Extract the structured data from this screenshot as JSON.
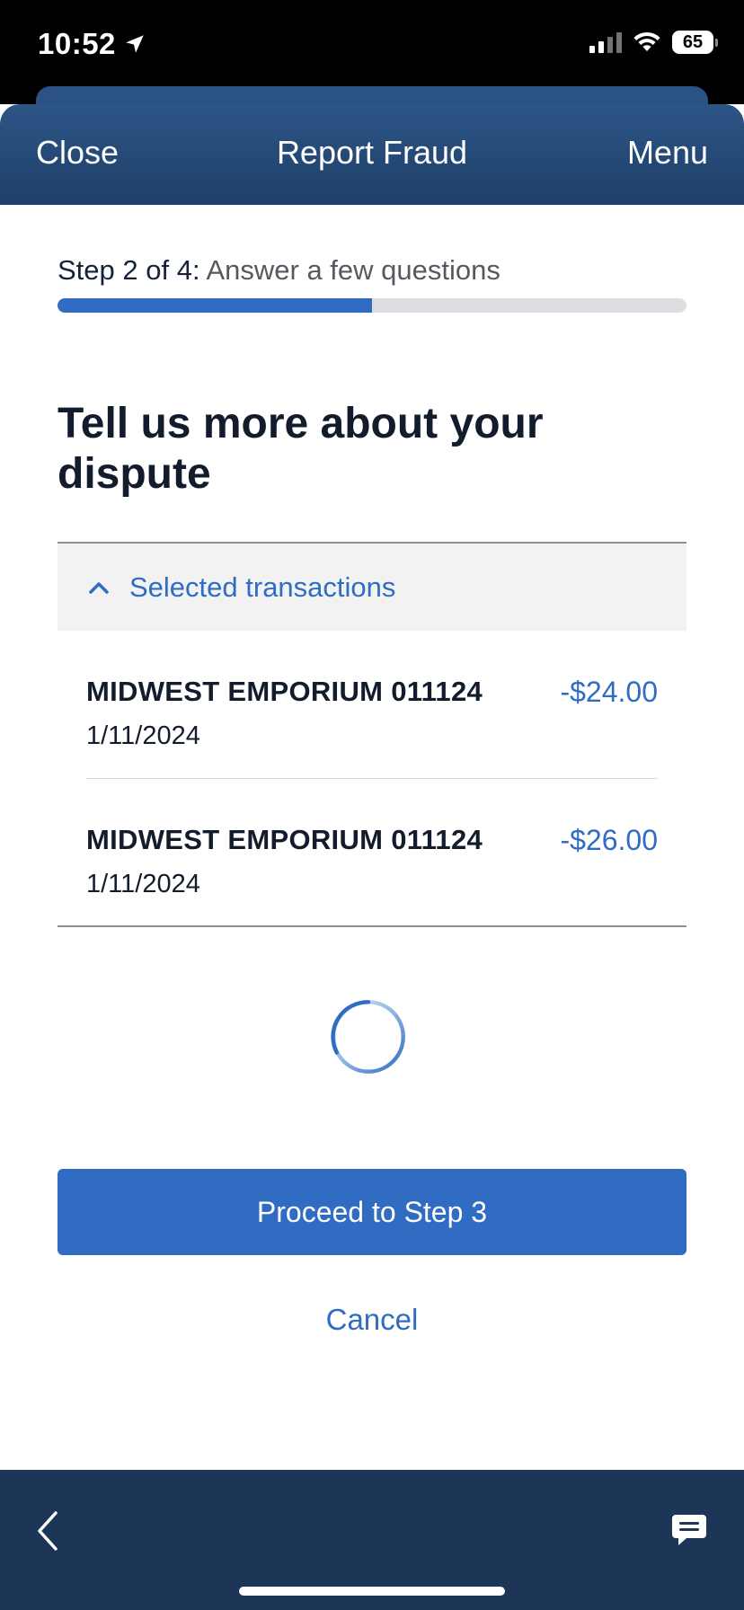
{
  "status_bar": {
    "time": "10:52",
    "battery_level": "65",
    "icons": [
      "location-arrow-icon",
      "cellular-signal-icon",
      "wifi-icon",
      "battery-icon"
    ]
  },
  "header": {
    "close_label": "Close",
    "title": "Report Fraud",
    "menu_label": "Menu"
  },
  "step": {
    "prefix": "Step 2 of 4:",
    "description": "Answer a few questions",
    "progress_fraction": 0.5
  },
  "main": {
    "heading": "Tell us more about your dispute"
  },
  "transactions": {
    "section_label": "Selected transactions",
    "expanded": true,
    "items": [
      {
        "merchant": "MIDWEST EMPORIUM 011124",
        "date": "1/11/2024",
        "amount": "-$24.00"
      },
      {
        "merchant": "MIDWEST EMPORIUM 011124",
        "date": "1/11/2024",
        "amount": "-$26.00"
      }
    ]
  },
  "actions": {
    "proceed_label": "Proceed to Step 3",
    "cancel_label": "Cancel"
  },
  "bottom_bar": {
    "icons": [
      "back-chevron-icon",
      "chat-icon"
    ]
  },
  "colors": {
    "accent": "#2f6cc2",
    "header": "#2c5586",
    "bottom_bar": "#1d3556",
    "heading_text": "#121c2c"
  }
}
